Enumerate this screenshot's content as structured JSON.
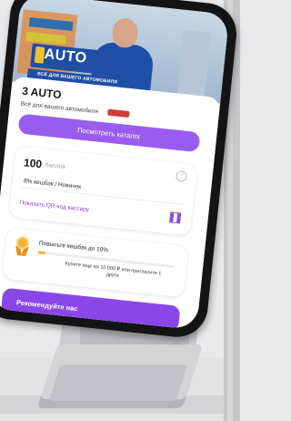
{
  "banner": {
    "logo_text": "AUTO",
    "logo_tagline": "ВСЁ ДЛЯ ВАШЕГО АВТОМОБИЛЯ"
  },
  "shop": {
    "title": "3 AUTO",
    "subtitle": "Всё для вашего автомобиля"
  },
  "catalog_button": "Посмотреть каталог",
  "bonus_card": {
    "points_value": "100",
    "points_label": "баллов",
    "info_icon": "info-icon",
    "status": "8% кешбэк / Новичок",
    "qr_link": "Показать QR-код кассиру",
    "qr_icon": "qr-code-icon"
  },
  "promo_card": {
    "title": "Повысьте кешбэк до 10%",
    "progress_fraction": 0.05,
    "note": "Купите еще на 10 000 ₽ или пригласите 1 друга",
    "icon": "medal-icon"
  },
  "recommend_button": "Рекомендуйте нас",
  "colors": {
    "accent": "#9a5cf0",
    "accent_dark": "#8a46e8",
    "brand_blue": "#1f4ea3",
    "medal_gold": "#f1b332"
  }
}
